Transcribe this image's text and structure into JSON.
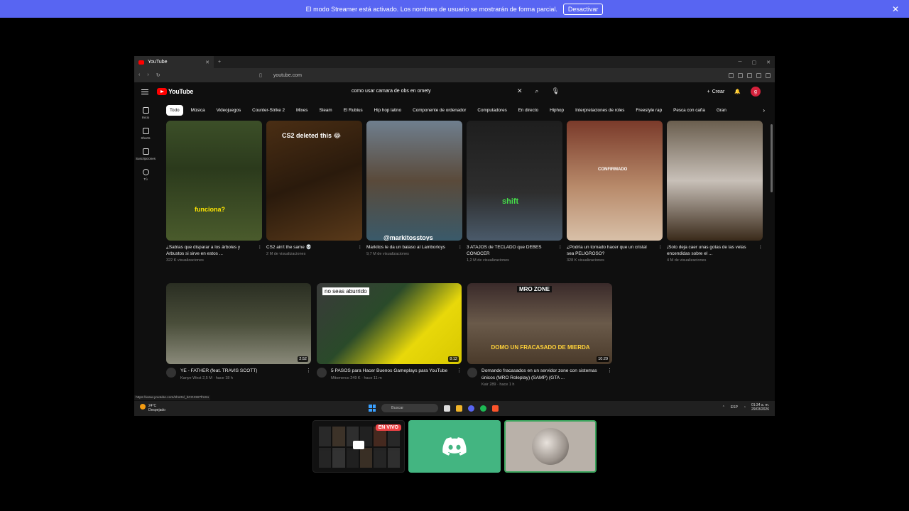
{
  "banner": {
    "message": "El modo Streamer está activado. Los nombres de usuario se mostrarán de forma parcial.",
    "button": "Desactivar"
  },
  "browser": {
    "tab_title": "YouTube",
    "url": "youtube.com"
  },
  "youtube": {
    "logo": "YouTube",
    "search_query": "como usar camara de obs en omety",
    "create_label": "Crear",
    "avatar_letter": "g",
    "chips": [
      "Todo",
      "Música",
      "Videojuegos",
      "Counter-Strike 2",
      "Mixes",
      "Steam",
      "El Rubius",
      "Hip hop latino",
      "Componente de ordenador",
      "Computadores",
      "En directo",
      "Hiphop",
      "Interpretaciones de roles",
      "Freestyle rap",
      "Pesca con caña",
      "Gran"
    ],
    "sidebar": [
      {
        "label": "Inicio",
        "icon": "home-icon"
      },
      {
        "label": "Shorts",
        "icon": "shorts-icon"
      },
      {
        "label": "Suscripciones",
        "icon": "subscriptions-icon"
      },
      {
        "label": "Tú",
        "icon": "user-icon"
      }
    ],
    "shorts": [
      {
        "title": "¿Sabías que disparar a los árboles y Arbustos si sirve en estos ...",
        "views": "322 K visualizaciones",
        "overlay": "funciona?"
      },
      {
        "title": "CS2 ain't the same 💀",
        "views": "2 M de visualizaciones",
        "overlay": "CS2 deleted this 😂"
      },
      {
        "title": "Markitos le da un balaso al Lamborloys",
        "views": "9,7 M de visualizaciones",
        "overlay": "@markitosstoys"
      },
      {
        "title": "3 ATAJOS de TECLADO que DEBES CONOCER",
        "views": "1,2 M de visualizaciones",
        "overlay": "shift"
      },
      {
        "title": "¿Podría un tornado hacer que un cristal sea PELIGROSO?",
        "views": "328 K visualizaciones",
        "overlay": "CONFIRMADO"
      },
      {
        "title": "¡Solo deja caer unas gotas de las velas encendidas sobre el ...",
        "views": "4 M de visualizaciones",
        "overlay": ""
      }
    ],
    "videos": [
      {
        "title": "YE - FATHER (feat. TRAVIS SCOTT)",
        "channel": "Kanye West",
        "meta": "2,5 M · hace 18 h",
        "duration": "2:52"
      },
      {
        "title": "5 PASOS para Hacer Buenos Gameplays para YouTube",
        "channel": "Mitomerco",
        "meta": "249 K · hace 11 m",
        "duration": "8:12",
        "overlay": "no seas aburrido"
      },
      {
        "title": "Domando fracasados en un servidor zone con sistemas únicos (MRO Roleplay) (SAMP) (GTA ...",
        "channel": "Kair",
        "meta": "289 · hace 1 h",
        "duration": "10:29",
        "overlay": "DOMO UN FRACASADO DE MIERDA",
        "badge": "MRO ZONE"
      }
    ],
    "status_url": "https://www.youtube.com/shorts/_bCGXW7fmSo"
  },
  "taskbar": {
    "weather_temp": "24°C",
    "weather_desc": "Despejado",
    "search_placeholder": "Buscar",
    "lang": "ESP",
    "time": "01:34 a. m.",
    "date": "29/03/2026"
  },
  "call": {
    "live_badge": "EN VIVO"
  },
  "colors": {
    "banner": "#5865f2",
    "discord_green": "#43b581",
    "yt_red": "#ff0000"
  }
}
